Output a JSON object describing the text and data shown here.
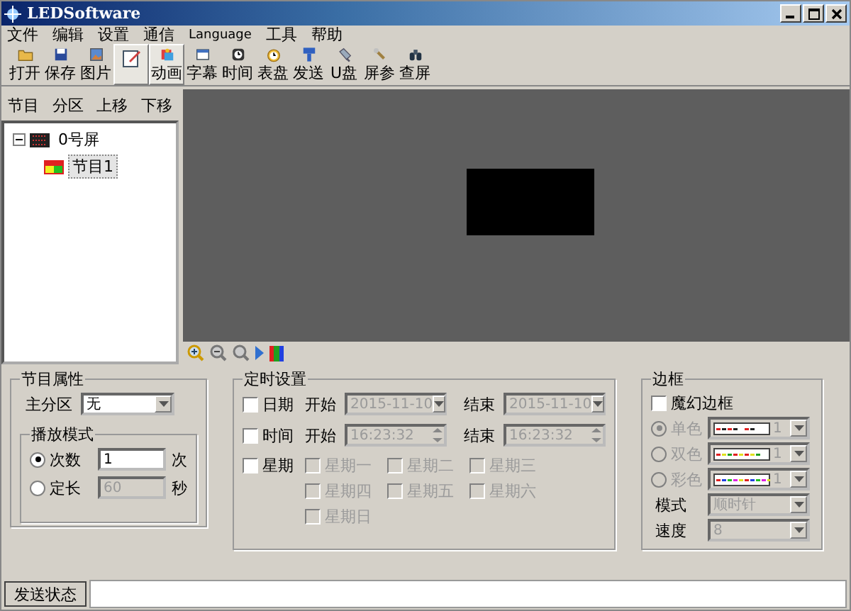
{
  "window": {
    "title": "LEDSoftware"
  },
  "menu": [
    "文件",
    "编辑",
    "设置",
    "通信",
    "Language",
    "工具",
    "帮助"
  ],
  "toolbar": [
    {
      "label": "打开",
      "pressed": false
    },
    {
      "label": "保存",
      "pressed": false
    },
    {
      "label": "图片",
      "pressed": false
    },
    {
      "pressed": true
    },
    {
      "label": "动画",
      "pressed": true
    },
    {
      "label": "字幕",
      "pressed": false
    },
    {
      "label": "时间",
      "pressed": false
    },
    {
      "label": "表盘",
      "pressed": false
    },
    {
      "label": "发送",
      "pressed": false
    },
    {
      "label": "U盘",
      "pressed": false
    },
    {
      "label": "屏参",
      "pressed": false
    },
    {
      "label": "查屏",
      "pressed": false
    }
  ],
  "program_panel": {
    "buttons": [
      "节目",
      "分区",
      "上移",
      "下移"
    ],
    "tree": [
      {
        "label": "0号屏",
        "expanded": true,
        "children": [
          {
            "label": "节目1",
            "selected": true
          }
        ]
      }
    ]
  },
  "program_props": {
    "title": "节目属性",
    "main_zone_label": "主分区",
    "main_zone_value": "无",
    "play_mode": {
      "title": "播放模式",
      "options": [
        {
          "label": "次数",
          "selected": true,
          "value": "1",
          "unit": "次"
        },
        {
          "label": "定长",
          "selected": false,
          "value": "60",
          "unit": "秒"
        }
      ]
    }
  },
  "timer": {
    "title": "定时设置",
    "rows": [
      {
        "kind": "date",
        "label": "日期",
        "checked": false,
        "start_label": "开始",
        "start": "2015-11-10",
        "end_label": "结束",
        "end": "2015-11-10"
      },
      {
        "kind": "time",
        "label": "时间",
        "checked": false,
        "start_label": "开始",
        "start": "16:23:32",
        "end_label": "结束",
        "end": "16:23:32"
      }
    ],
    "weekday": {
      "label": "星期",
      "checked": false,
      "days": [
        {
          "label": "星期一",
          "checked": false
        },
        {
          "label": "星期二",
          "checked": false
        },
        {
          "label": "星期三",
          "checked": false
        },
        {
          "label": "星期四",
          "checked": false
        },
        {
          "label": "星期五",
          "checked": false
        },
        {
          "label": "星期六",
          "checked": false
        },
        {
          "label": "星期日",
          "checked": false
        }
      ]
    }
  },
  "border": {
    "title": "边框",
    "magic": {
      "label": "魔幻边框",
      "checked": false
    },
    "styles": [
      {
        "label": "单色",
        "selected": true,
        "value": "1"
      },
      {
        "label": "双色",
        "selected": false,
        "value": "1"
      },
      {
        "label": "彩色",
        "selected": false,
        "value": "1"
      }
    ],
    "mode": {
      "label": "模式",
      "value": "顺时针"
    },
    "speed": {
      "label": "速度",
      "value": "8"
    }
  },
  "status": {
    "button": "发送状态"
  }
}
